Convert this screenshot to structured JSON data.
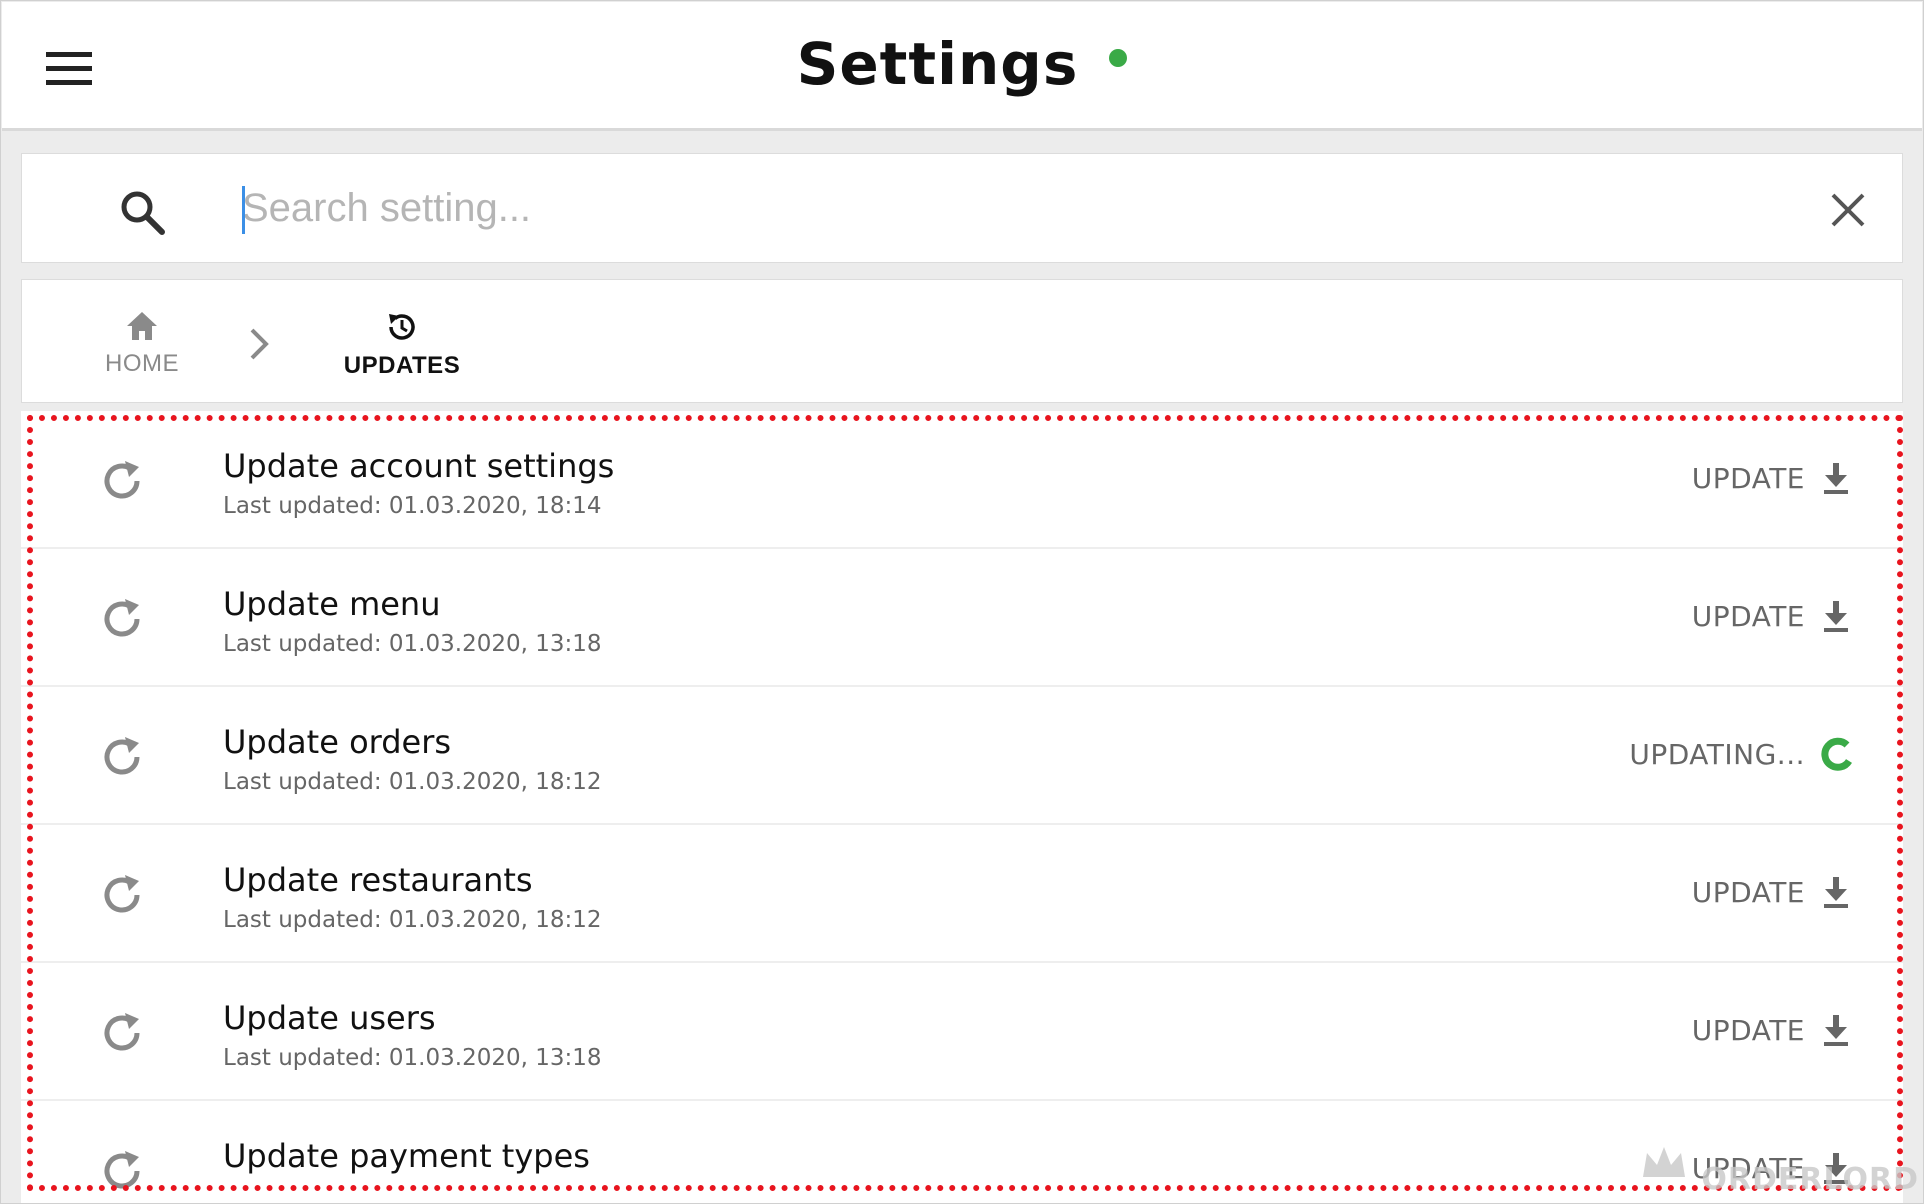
{
  "header": {
    "title": "Settings",
    "status_color": "#3aaa47",
    "menu_icon": "hamburger-menu-icon"
  },
  "search": {
    "placeholder": "Search setting...",
    "value": "",
    "search_icon": "search-icon",
    "clear_icon": "close-icon"
  },
  "breadcrumb": {
    "home_label": "HOME",
    "home_icon": "home-icon",
    "separator_icon": "chevron-right-icon",
    "current_label": "UPDATES",
    "current_icon": "history-icon"
  },
  "updates": [
    {
      "title": "Update account settings",
      "last_updated": "Last updated: 01.03.2020, 18:14",
      "action": "UPDATE",
      "state": "idle"
    },
    {
      "title": "Update menu",
      "last_updated": "Last updated: 01.03.2020, 13:18",
      "action": "UPDATE",
      "state": "idle"
    },
    {
      "title": "Update orders",
      "last_updated": "Last updated: 01.03.2020, 18:12",
      "action": "UPDATING...",
      "state": "updating"
    },
    {
      "title": "Update restaurants",
      "last_updated": "Last updated: 01.03.2020, 18:12",
      "action": "UPDATE",
      "state": "idle"
    },
    {
      "title": "Update users",
      "last_updated": "Last updated: 01.03.2020, 13:18",
      "action": "UPDATE",
      "state": "idle"
    },
    {
      "title": "Update payment types",
      "last_updated": "",
      "action": "UPDATE",
      "state": "idle"
    }
  ],
  "colors": {
    "accent_green": "#3aaa47",
    "highlight_red": "#e8141e",
    "icon_gray": "#8a8a8a"
  },
  "watermark": "ORDERLORD"
}
